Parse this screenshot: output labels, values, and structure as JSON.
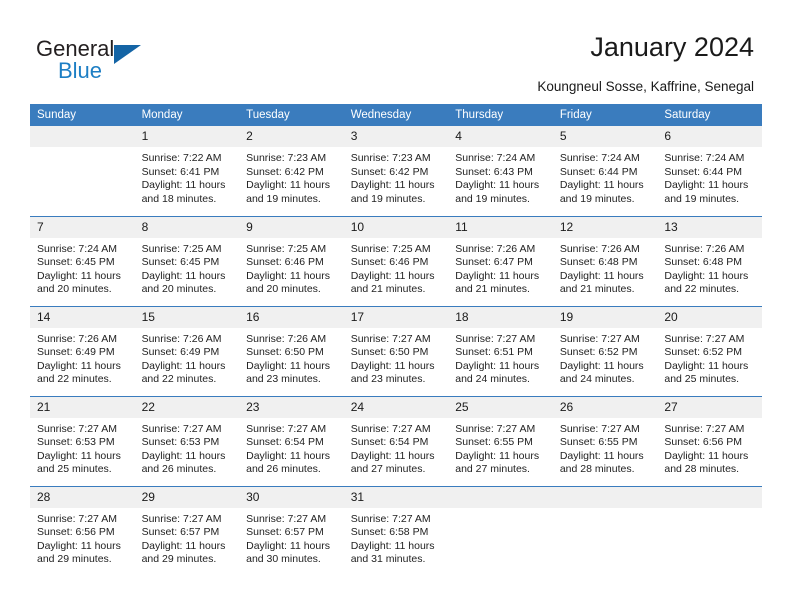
{
  "brand": {
    "name_part1": "General",
    "name_part2": "Blue",
    "accent_color": "#1d7ec4",
    "triangle_color": "#1464a5"
  },
  "header": {
    "title": "January 2024",
    "subtitle": "Koungneul Sosse, Kaffrine, Senegal"
  },
  "calendar": {
    "header_color": "#3a7cbe",
    "daynum_band_color": "#f0f0f0",
    "weekdays": [
      "Sunday",
      "Monday",
      "Tuesday",
      "Wednesday",
      "Thursday",
      "Friday",
      "Saturday"
    ],
    "weeks": [
      [
        {
          "day": "",
          "sunrise": "",
          "sunset": "",
          "daylight1": "",
          "daylight2": ""
        },
        {
          "day": "1",
          "sunrise": "Sunrise: 7:22 AM",
          "sunset": "Sunset: 6:41 PM",
          "daylight1": "Daylight: 11 hours",
          "daylight2": "and 18 minutes."
        },
        {
          "day": "2",
          "sunrise": "Sunrise: 7:23 AM",
          "sunset": "Sunset: 6:42 PM",
          "daylight1": "Daylight: 11 hours",
          "daylight2": "and 19 minutes."
        },
        {
          "day": "3",
          "sunrise": "Sunrise: 7:23 AM",
          "sunset": "Sunset: 6:42 PM",
          "daylight1": "Daylight: 11 hours",
          "daylight2": "and 19 minutes."
        },
        {
          "day": "4",
          "sunrise": "Sunrise: 7:24 AM",
          "sunset": "Sunset: 6:43 PM",
          "daylight1": "Daylight: 11 hours",
          "daylight2": "and 19 minutes."
        },
        {
          "day": "5",
          "sunrise": "Sunrise: 7:24 AM",
          "sunset": "Sunset: 6:44 PM",
          "daylight1": "Daylight: 11 hours",
          "daylight2": "and 19 minutes."
        },
        {
          "day": "6",
          "sunrise": "Sunrise: 7:24 AM",
          "sunset": "Sunset: 6:44 PM",
          "daylight1": "Daylight: 11 hours",
          "daylight2": "and 19 minutes."
        }
      ],
      [
        {
          "day": "7",
          "sunrise": "Sunrise: 7:24 AM",
          "sunset": "Sunset: 6:45 PM",
          "daylight1": "Daylight: 11 hours",
          "daylight2": "and 20 minutes."
        },
        {
          "day": "8",
          "sunrise": "Sunrise: 7:25 AM",
          "sunset": "Sunset: 6:45 PM",
          "daylight1": "Daylight: 11 hours",
          "daylight2": "and 20 minutes."
        },
        {
          "day": "9",
          "sunrise": "Sunrise: 7:25 AM",
          "sunset": "Sunset: 6:46 PM",
          "daylight1": "Daylight: 11 hours",
          "daylight2": "and 20 minutes."
        },
        {
          "day": "10",
          "sunrise": "Sunrise: 7:25 AM",
          "sunset": "Sunset: 6:46 PM",
          "daylight1": "Daylight: 11 hours",
          "daylight2": "and 21 minutes."
        },
        {
          "day": "11",
          "sunrise": "Sunrise: 7:26 AM",
          "sunset": "Sunset: 6:47 PM",
          "daylight1": "Daylight: 11 hours",
          "daylight2": "and 21 minutes."
        },
        {
          "day": "12",
          "sunrise": "Sunrise: 7:26 AM",
          "sunset": "Sunset: 6:48 PM",
          "daylight1": "Daylight: 11 hours",
          "daylight2": "and 21 minutes."
        },
        {
          "day": "13",
          "sunrise": "Sunrise: 7:26 AM",
          "sunset": "Sunset: 6:48 PM",
          "daylight1": "Daylight: 11 hours",
          "daylight2": "and 22 minutes."
        }
      ],
      [
        {
          "day": "14",
          "sunrise": "Sunrise: 7:26 AM",
          "sunset": "Sunset: 6:49 PM",
          "daylight1": "Daylight: 11 hours",
          "daylight2": "and 22 minutes."
        },
        {
          "day": "15",
          "sunrise": "Sunrise: 7:26 AM",
          "sunset": "Sunset: 6:49 PM",
          "daylight1": "Daylight: 11 hours",
          "daylight2": "and 22 minutes."
        },
        {
          "day": "16",
          "sunrise": "Sunrise: 7:26 AM",
          "sunset": "Sunset: 6:50 PM",
          "daylight1": "Daylight: 11 hours",
          "daylight2": "and 23 minutes."
        },
        {
          "day": "17",
          "sunrise": "Sunrise: 7:27 AM",
          "sunset": "Sunset: 6:50 PM",
          "daylight1": "Daylight: 11 hours",
          "daylight2": "and 23 minutes."
        },
        {
          "day": "18",
          "sunrise": "Sunrise: 7:27 AM",
          "sunset": "Sunset: 6:51 PM",
          "daylight1": "Daylight: 11 hours",
          "daylight2": "and 24 minutes."
        },
        {
          "day": "19",
          "sunrise": "Sunrise: 7:27 AM",
          "sunset": "Sunset: 6:52 PM",
          "daylight1": "Daylight: 11 hours",
          "daylight2": "and 24 minutes."
        },
        {
          "day": "20",
          "sunrise": "Sunrise: 7:27 AM",
          "sunset": "Sunset: 6:52 PM",
          "daylight1": "Daylight: 11 hours",
          "daylight2": "and 25 minutes."
        }
      ],
      [
        {
          "day": "21",
          "sunrise": "Sunrise: 7:27 AM",
          "sunset": "Sunset: 6:53 PM",
          "daylight1": "Daylight: 11 hours",
          "daylight2": "and 25 minutes."
        },
        {
          "day": "22",
          "sunrise": "Sunrise: 7:27 AM",
          "sunset": "Sunset: 6:53 PM",
          "daylight1": "Daylight: 11 hours",
          "daylight2": "and 26 minutes."
        },
        {
          "day": "23",
          "sunrise": "Sunrise: 7:27 AM",
          "sunset": "Sunset: 6:54 PM",
          "daylight1": "Daylight: 11 hours",
          "daylight2": "and 26 minutes."
        },
        {
          "day": "24",
          "sunrise": "Sunrise: 7:27 AM",
          "sunset": "Sunset: 6:54 PM",
          "daylight1": "Daylight: 11 hours",
          "daylight2": "and 27 minutes."
        },
        {
          "day": "25",
          "sunrise": "Sunrise: 7:27 AM",
          "sunset": "Sunset: 6:55 PM",
          "daylight1": "Daylight: 11 hours",
          "daylight2": "and 27 minutes."
        },
        {
          "day": "26",
          "sunrise": "Sunrise: 7:27 AM",
          "sunset": "Sunset: 6:55 PM",
          "daylight1": "Daylight: 11 hours",
          "daylight2": "and 28 minutes."
        },
        {
          "day": "27",
          "sunrise": "Sunrise: 7:27 AM",
          "sunset": "Sunset: 6:56 PM",
          "daylight1": "Daylight: 11 hours",
          "daylight2": "and 28 minutes."
        }
      ],
      [
        {
          "day": "28",
          "sunrise": "Sunrise: 7:27 AM",
          "sunset": "Sunset: 6:56 PM",
          "daylight1": "Daylight: 11 hours",
          "daylight2": "and 29 minutes."
        },
        {
          "day": "29",
          "sunrise": "Sunrise: 7:27 AM",
          "sunset": "Sunset: 6:57 PM",
          "daylight1": "Daylight: 11 hours",
          "daylight2": "and 29 minutes."
        },
        {
          "day": "30",
          "sunrise": "Sunrise: 7:27 AM",
          "sunset": "Sunset: 6:57 PM",
          "daylight1": "Daylight: 11 hours",
          "daylight2": "and 30 minutes."
        },
        {
          "day": "31",
          "sunrise": "Sunrise: 7:27 AM",
          "sunset": "Sunset: 6:58 PM",
          "daylight1": "Daylight: 11 hours",
          "daylight2": "and 31 minutes."
        },
        {
          "day": "",
          "sunrise": "",
          "sunset": "",
          "daylight1": "",
          "daylight2": ""
        },
        {
          "day": "",
          "sunrise": "",
          "sunset": "",
          "daylight1": "",
          "daylight2": ""
        },
        {
          "day": "",
          "sunrise": "",
          "sunset": "",
          "daylight1": "",
          "daylight2": ""
        }
      ]
    ]
  }
}
